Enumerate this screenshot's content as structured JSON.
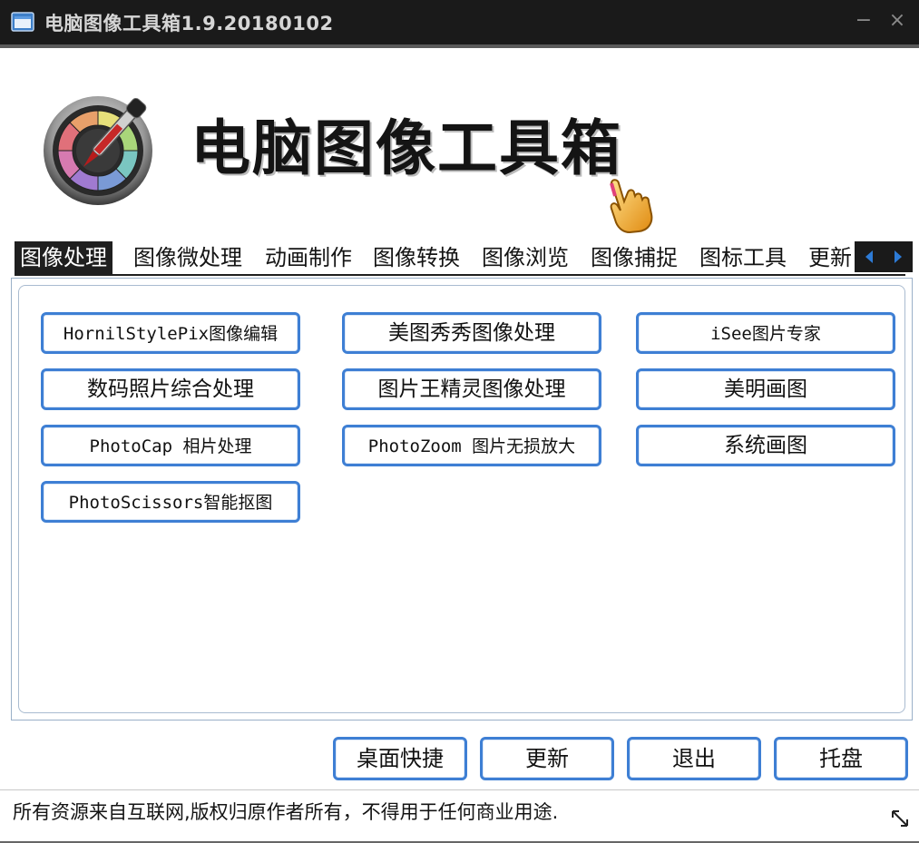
{
  "window": {
    "title": "电脑图像工具箱1.9.20180102",
    "minimize_glyph": "−",
    "close_glyph": "×"
  },
  "header": {
    "banner_text": "电脑图像工具箱",
    "logo_icon": "color-wheel-dropper-icon",
    "cursor_icon": "hand-pointer-icon"
  },
  "tabs": [
    {
      "label": "图像处理",
      "active": true
    },
    {
      "label": "图像微处理"
    },
    {
      "label": "动画制作"
    },
    {
      "label": "图像转换"
    },
    {
      "label": "图像浏览"
    },
    {
      "label": "图像捕捉"
    },
    {
      "label": "图标工具"
    },
    {
      "label": "更新"
    }
  ],
  "tools": [
    {
      "label": "HornilStylePix图像编辑"
    },
    {
      "label": "美图秀秀图像处理"
    },
    {
      "label": "iSee图片专家"
    },
    {
      "label": "数码照片综合处理"
    },
    {
      "label": "图片王精灵图像处理"
    },
    {
      "label": "美明画图"
    },
    {
      "label": "PhotoCap 相片处理"
    },
    {
      "label": "PhotoZoom 图片无损放大"
    },
    {
      "label": "系统画图"
    },
    {
      "label": "PhotoScissors智能抠图"
    }
  ],
  "bottom_buttons": {
    "desktop_shortcut": "桌面快捷",
    "update": "更新",
    "exit": "退出",
    "tray": "托盘"
  },
  "status_text": "所有资源来自互联网,版权归原作者所有，不得用于任何商业用途.",
  "colors": {
    "titlebar_bg": "#1a1a1a",
    "button_border": "#3e7fd4",
    "active_tab_bg": "#1f1f1f",
    "arrow_blue": "#2d7bd6"
  }
}
